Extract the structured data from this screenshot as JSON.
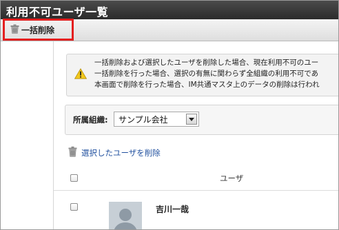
{
  "window": {
    "title": "利用不可ユーザ一覧"
  },
  "toolbar": {
    "bulk_delete_label": "一括削除",
    "bulk_delete_icon": "trash-icon"
  },
  "alert": {
    "icon": "warning-icon",
    "lines": [
      "一括削除および選択したユーザを削除した場合、現在利用不可のユー",
      "一括削除を行った場合、選択の有無に関わらず全組織の利用不可であ",
      "本画面で削除を行った場合、IM共通マスタ上のデータの削除は行われ"
    ]
  },
  "filter": {
    "label": "所属組織:",
    "selected": "サンプル会社"
  },
  "list": {
    "delete_selected_label": "選択したユーザを削除",
    "column_user": "ユーザ",
    "rows": [
      {
        "name": "吉川一哉"
      }
    ]
  },
  "colors": {
    "titlebar": "#333333",
    "highlight": "#e41f1f",
    "link": "#1f4f9e",
    "warning": "#f2c81c"
  }
}
